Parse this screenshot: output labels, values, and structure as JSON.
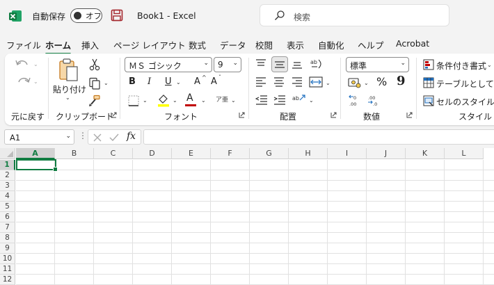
{
  "titlebar": {
    "autosave_label": "自動保存",
    "autosave_state": "オフ",
    "document_title": "Book1  -  Excel",
    "search_placeholder": "検索"
  },
  "menu_tabs": [
    "ファイル",
    "ホーム",
    "挿入",
    "ページ レイアウト",
    "数式",
    "データ",
    "校閲",
    "表示",
    "自動化",
    "ヘルプ",
    "Acrobat"
  ],
  "active_tab": "ホーム",
  "ribbon": {
    "undo_group": {
      "label": "元に戻す"
    },
    "clipboard": {
      "label": "クリップボード",
      "paste_label": "貼り付け"
    },
    "font": {
      "label": "フォント",
      "font_name": "ＭＳ ゴシック",
      "font_size": "9",
      "bold": "B",
      "italic": "I",
      "underline": "U",
      "grow": "A",
      "shrink": "A",
      "font_color_letter": "A",
      "furigana": "ア亜"
    },
    "alignment": {
      "label": "配置"
    },
    "number": {
      "label": "数値",
      "format": "標準",
      "percent": "%",
      "comma": "9"
    },
    "styles": {
      "label": "スタイル",
      "conditional": "条件付き書式",
      "table": "テーブルとして書式",
      "cell_styles": "セルのスタイル"
    }
  },
  "formula_bar": {
    "name_box": "A1",
    "fx": "fx",
    "value": ""
  },
  "grid": {
    "columns": [
      "A",
      "B",
      "C",
      "D",
      "E",
      "F",
      "G",
      "H",
      "I",
      "J",
      "K",
      "L"
    ],
    "rows": [
      "1",
      "2",
      "3",
      "4",
      "5",
      "6",
      "7",
      "8",
      "9",
      "10",
      "11",
      "12"
    ],
    "selected_cell": "A1"
  },
  "colors": {
    "accent": "#107c41",
    "save_icon": "#a4262c",
    "font_color_bar": "#c00000",
    "highlight_bar": "#ffff00"
  }
}
